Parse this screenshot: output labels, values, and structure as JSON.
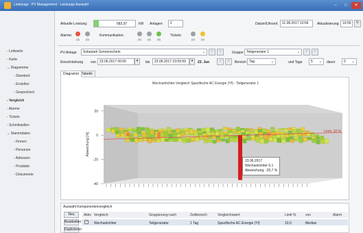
{
  "window": {
    "title": "Leistungs · PV Management · Leistungs Auswahl"
  },
  "sidebar": {
    "items": [
      {
        "label": "Leitwarte"
      },
      {
        "label": "Karte"
      },
      {
        "label": "Diagramme"
      },
      {
        "label": "Standard"
      },
      {
        "label": "Erstellen"
      },
      {
        "label": "Gespeichert"
      },
      {
        "label": "Vergleich"
      },
      {
        "label": "Alarme"
      },
      {
        "label": "Tickets"
      },
      {
        "label": "Schnittstellen"
      },
      {
        "label": "Stammdaten"
      },
      {
        "label": "Firmen"
      },
      {
        "label": "Personen"
      },
      {
        "label": "Adressen"
      },
      {
        "label": "Produkte"
      },
      {
        "label": "Dokumente"
      }
    ]
  },
  "status": {
    "leistung_label": "Aktuelle Leistung:",
    "leistung_value": "683,97",
    "leistung_unit": "kW",
    "leistung_fill": 0.12,
    "anlagen_label": "Anlagen:",
    "anlagen_value": "2",
    "datetime_label": "Datum/Uhrzeit:",
    "datetime_value": "11.08.2017 10:56",
    "refresh_label": "Aktualisierung:",
    "refresh_value": "10:56",
    "alarme_label": "Alarme:",
    "kommunikation_label": "Kommunikation:",
    "tickets_label": "Tickets:",
    "alarm_counts": [
      "(3)",
      "(0)"
    ],
    "komm_counts": [
      "(0)",
      "(0)",
      "(5)"
    ],
    "ticket_counts": [
      "(0)",
      "(0)"
    ]
  },
  "filters": {
    "pv_label": "PV-Anlage",
    "pv_value": "Solarpark Sonnenschein",
    "gruppe_label": "Gruppe",
    "gruppe_value": "Teilgenerator 1",
    "range_label": "Einschränkung",
    "von_label": "von",
    "von_value": "23.06.2017 00:00",
    "bis_label": "bis",
    "bis_value": "23.06.2017 23:59:59",
    "day": "23. Jun",
    "bereich_label": "Bereich",
    "bereich_value": "Tag",
    "tage_label": "und Tage",
    "tage_value": "5",
    "davor_label": "davor",
    "davor_value": "0"
  },
  "tabs": [
    {
      "label": "Diagramm"
    },
    {
      "label": "Tabelle"
    }
  ],
  "chart_data": {
    "type": "heatmap",
    "title": "Wechselrichter Vergleich Spezifische AC Energie (Yf) - Teilgenerator 1",
    "ylabel": "Abweichung [%]",
    "yticks": [
      "20",
      "0",
      "-20",
      "-40"
    ],
    "ylim": [
      -40,
      25
    ],
    "limit_label": "Limit: 10 %",
    "tooltip": {
      "date": "23.06.2017",
      "name": "Wechselrichter 6.1",
      "deviation": "Abweichung: -25,7 %",
      "value": -25.7
    }
  },
  "compare": {
    "title": "Auswahl Komponentenvergleich",
    "new_button": "Neu",
    "edit_button": "Bearbeiten",
    "delete_button": "Duplizieren",
    "headers": [
      "Aktiv",
      "Vergleich",
      "Gruppierung nach",
      "Zeitbereich",
      "Vergleichswert",
      "Limit %",
      "von",
      "Alarm"
    ],
    "row": [
      "Wechselrichter",
      "Teilgenerator",
      "1 Tag",
      "Spezifische AC Energie (Yf)",
      "10,0",
      "Median"
    ]
  }
}
